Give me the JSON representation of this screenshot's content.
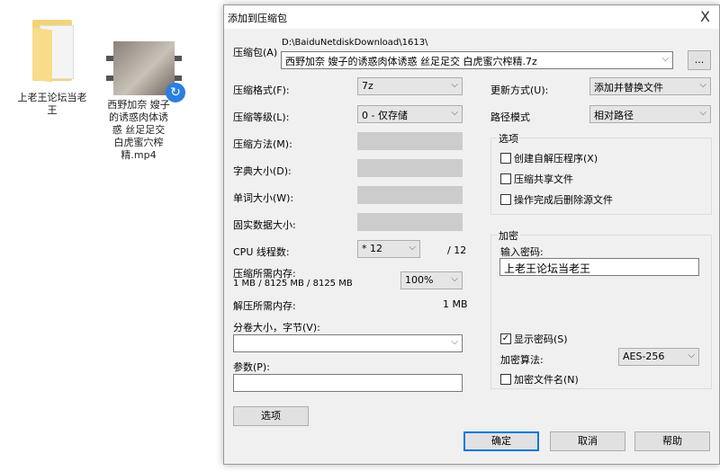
{
  "desktop": {
    "items": [
      {
        "label": "上老王论坛当老王",
        "type": "folder"
      },
      {
        "label": "西野加奈 嫂子的诱惑肉体诱惑 丝足足交 白虎蜜穴榨精.mp4",
        "type": "video"
      }
    ]
  },
  "dialog": {
    "title": "添加到压缩包",
    "close": "X",
    "archive_label": "压缩包(A)",
    "archive_path": "D:\\BaiduNetdiskDownload\\1613\\",
    "archive_name": "西野加奈 嫂子的诱惑肉体诱惑 丝足足交 白虎蜜穴榨精.7z",
    "browse": "...",
    "format_label": "压缩格式(F):",
    "format": "7z",
    "level_label": "压缩等级(L):",
    "level": "0 - 仅存储",
    "method_label": "压缩方法(M):",
    "dict_label": "字典大小(D):",
    "word_label": "单词大小(W):",
    "solid_label": "固实数据大小:",
    "cpu_label": "CPU 线程数:",
    "cpu": "* 12",
    "cpu_max": "/ 12",
    "mem_label": "压缩所需内存:",
    "mem_value": "1 MB / 8125 MB / 8125 MB",
    "mem_pct": "100%",
    "demem_label": "解压所需内存:",
    "demem_value": "1 MB",
    "split_label": "分卷大小，字节(V):",
    "split_value": "",
    "params_label": "参数(P):",
    "params_value": "",
    "options_button": "选项",
    "update_label": "更新方式(U):",
    "update": "添加并替换文件",
    "path_label": "路径模式",
    "path": "相对路径",
    "options_group": "选项",
    "opt_sfx": "创建自解压程序(X)",
    "opt_shared": "压缩共享文件",
    "opt_delete": "操作完成后删除源文件",
    "enc_group": "加密",
    "pw_label": "输入密码:",
    "password": "上老王论坛当老王",
    "show_pw": "显示密码(S)",
    "enc_method_label": "加密算法:",
    "enc_method": "AES-256",
    "enc_names": "加密文件名(N)",
    "ok": "确定",
    "cancel": "取消",
    "help": "帮助"
  }
}
